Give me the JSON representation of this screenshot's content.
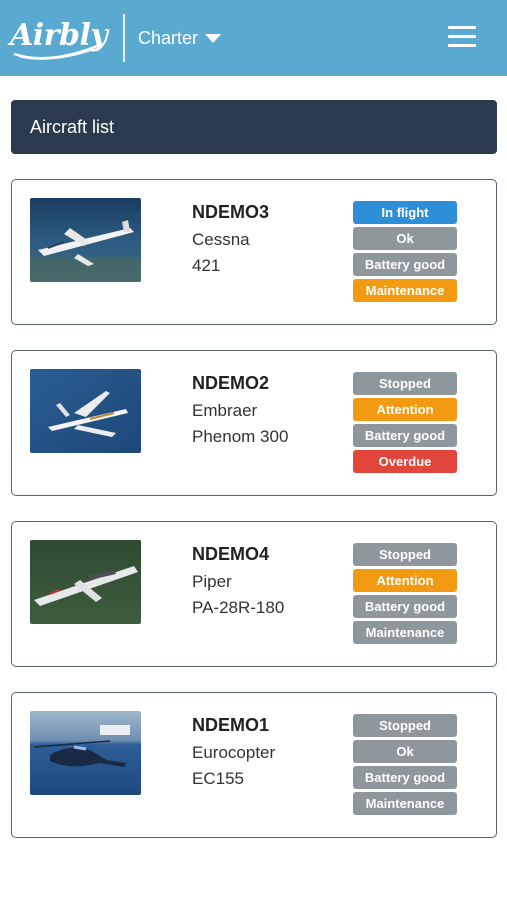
{
  "header": {
    "brand": "Airbly",
    "section": "Charter"
  },
  "list": {
    "title": "Aircraft list"
  },
  "aircraft": [
    {
      "registration": "NDEMO3",
      "make": "Cessna",
      "model": "421",
      "badges": [
        {
          "label": "In flight",
          "color": "#2d8fd7"
        },
        {
          "label": "Ok",
          "color": "#8e979b"
        },
        {
          "label": "Battery good",
          "color": "#8e979b"
        },
        {
          "label": "Maintenance",
          "color": "#f39a13"
        }
      ]
    },
    {
      "registration": "NDEMO2",
      "make": "Embraer",
      "model": "Phenom 300",
      "badges": [
        {
          "label": "Stopped",
          "color": "#8e979b"
        },
        {
          "label": "Attention",
          "color": "#f39a13"
        },
        {
          "label": "Battery good",
          "color": "#8e979b"
        },
        {
          "label": "Overdue",
          "color": "#e1453c"
        }
      ]
    },
    {
      "registration": "NDEMO4",
      "make": "Piper",
      "model": "PA-28R-180",
      "badges": [
        {
          "label": "Stopped",
          "color": "#8e979b"
        },
        {
          "label": "Attention",
          "color": "#f39a13"
        },
        {
          "label": "Battery good",
          "color": "#8e979b"
        },
        {
          "label": "Maintenance",
          "color": "#8e979b"
        }
      ]
    },
    {
      "registration": "NDEMO1",
      "make": "Eurocopter",
      "model": "EC155",
      "badges": [
        {
          "label": "Stopped",
          "color": "#8e979b"
        },
        {
          "label": "Ok",
          "color": "#8e979b"
        },
        {
          "label": "Battery good",
          "color": "#8e979b"
        },
        {
          "label": "Maintenance",
          "color": "#8e979b"
        }
      ]
    }
  ],
  "colors": {
    "topbar": "#5aa9d0",
    "list_header": "#2c3a4d"
  }
}
